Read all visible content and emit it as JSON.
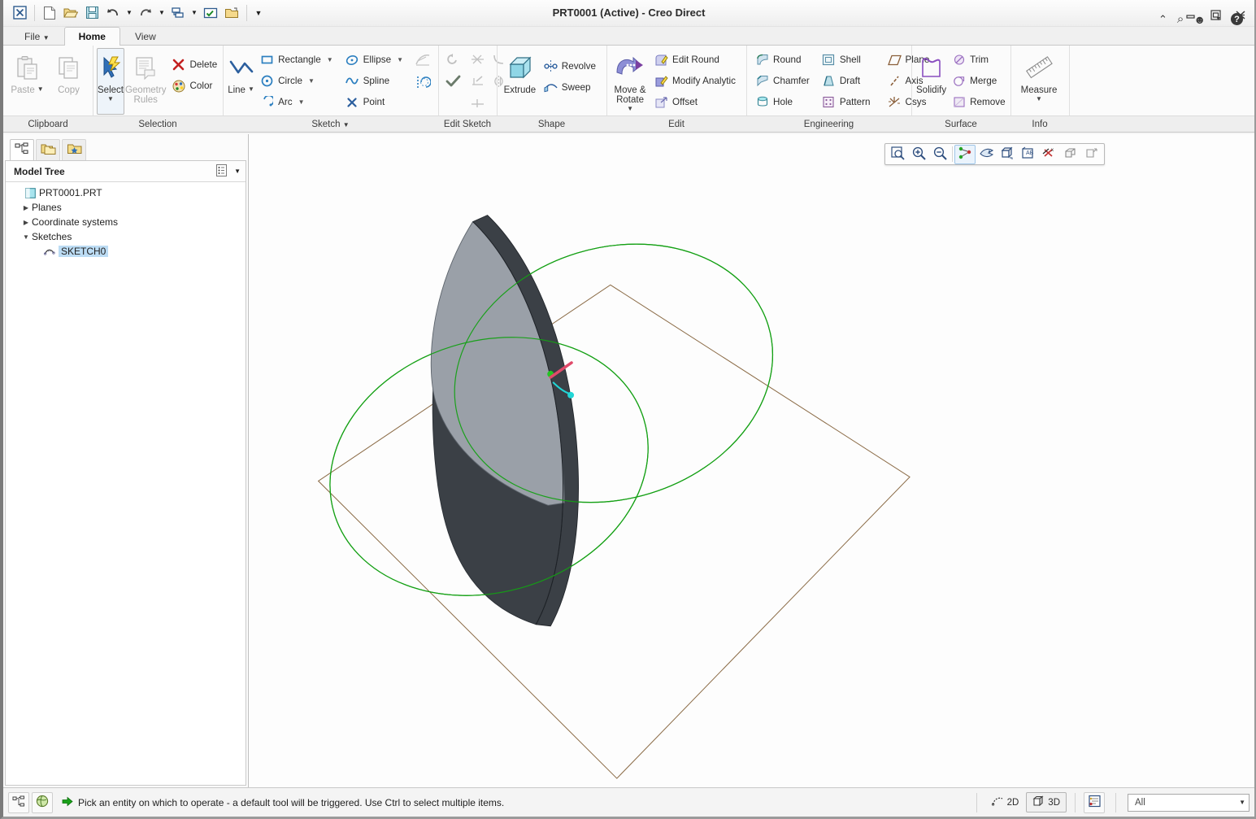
{
  "window": {
    "title": "PRT0001 (Active) - Creo Direct",
    "controls": [
      {
        "name": "minimize-button",
        "glyph": "–"
      },
      {
        "name": "restore-button",
        "glyph": "❐"
      },
      {
        "name": "close-button",
        "glyph": "✖"
      }
    ]
  },
  "quick_access": [
    {
      "name": "app-logo-icon",
      "label": "Creo Direct"
    },
    {
      "name": "new-icon",
      "label": "New"
    },
    {
      "name": "open-icon",
      "label": "Open"
    },
    {
      "name": "save-icon",
      "label": "Save"
    },
    {
      "name": "undo-icon",
      "label": "Undo"
    },
    {
      "name": "redo-icon",
      "label": "Redo"
    },
    {
      "name": "regenerate-icon",
      "label": "Regenerate"
    },
    {
      "name": "select-working-directory-icon",
      "label": "Select Working Directory"
    },
    {
      "name": "open-last-session-icon",
      "label": "Open Last Session"
    },
    {
      "name": "customize-quick-access-icon",
      "label": "Customize Quick Access Toolbar"
    }
  ],
  "help_icons": [
    {
      "name": "minimize-ribbon-icon",
      "glyph": "⌃"
    },
    {
      "name": "search-icon",
      "glyph": "⌕"
    },
    {
      "name": "account-icon",
      "glyph": "☺"
    },
    {
      "name": "account-dropdown-icon",
      "glyph": "▼"
    },
    {
      "name": "help-icon",
      "glyph": "?"
    }
  ],
  "tabs": [
    {
      "label": "File",
      "active": false,
      "has_caret": true
    },
    {
      "label": "Home",
      "active": true,
      "has_caret": false
    },
    {
      "label": "View",
      "active": false,
      "has_caret": false
    }
  ],
  "ribbon": {
    "groups": [
      {
        "name": "clipboard",
        "label": "Clipboard",
        "big_buttons": [
          {
            "label": "Paste",
            "icon": "paste-icon",
            "caret": true,
            "disabled": true
          },
          {
            "label": "Copy",
            "icon": "copy-icon",
            "caret": false,
            "disabled": true
          }
        ]
      },
      {
        "name": "selection",
        "label": "Selection",
        "big_buttons": [
          {
            "label": "Select",
            "icon": "select-arrow-icon",
            "caret": true,
            "disabled": false,
            "selected": true
          },
          {
            "label": "Geometry Rules",
            "icon": "geometry-rules-icon",
            "caret": false,
            "disabled": true
          }
        ],
        "small_buttons": [
          {
            "label": "Delete",
            "icon": "delete-icon",
            "disabled": false
          },
          {
            "label": "Color",
            "icon": "color-icon",
            "disabled": false
          }
        ]
      },
      {
        "name": "sketch",
        "label": "Sketch",
        "label_caret": true,
        "big_buttons": [
          {
            "label": "Line",
            "icon": "line-icon",
            "caret": true,
            "disabled": false
          }
        ],
        "columns": [
          [
            {
              "label": "Rectangle",
              "icon": "rectangle-icon",
              "caret": true
            },
            {
              "label": "Circle",
              "icon": "circle-icon",
              "caret": true
            },
            {
              "label": "Arc",
              "icon": "arc-icon",
              "caret": true
            }
          ],
          [
            {
              "label": "Ellipse",
              "icon": "ellipse-icon",
              "caret": true
            },
            {
              "label": "Spline",
              "icon": "spline-icon",
              "caret": false
            },
            {
              "label": "Point",
              "icon": "point-icon",
              "caret": false
            }
          ]
        ],
        "icon_only": [
          {
            "name": "chamfer-sketch-icon",
            "disabled": true
          },
          {
            "name": "offset-edge-icon",
            "disabled": false
          }
        ]
      },
      {
        "name": "edit-sketch",
        "label": "Edit Sketch",
        "icon_only": [
          {
            "name": "undo-sketch-icon",
            "disabled": true
          },
          {
            "name": "accept-sketch-icon",
            "disabled": false
          },
          {
            "name": "trim-sketch-icon",
            "disabled": true
          },
          {
            "name": "corner-sketch-icon",
            "disabled": true
          },
          {
            "name": "extend-sketch-icon",
            "disabled": true
          },
          {
            "name": "mirror-sketch-icon",
            "disabled": true
          },
          {
            "name": "divide-sketch-icon",
            "disabled": true
          }
        ]
      },
      {
        "name": "shape",
        "label": "Shape",
        "big_buttons": [
          {
            "label": "Extrude",
            "icon": "extrude-icon",
            "caret": false,
            "disabled": false
          }
        ],
        "small_buttons": [
          {
            "label": "Revolve",
            "icon": "revolve-icon"
          },
          {
            "label": "Sweep",
            "icon": "sweep-icon"
          }
        ]
      },
      {
        "name": "edit",
        "label": "Edit",
        "big_buttons": [
          {
            "label": "Move & Rotate",
            "icon": "move-rotate-icon",
            "caret": true,
            "disabled": false
          }
        ],
        "small_buttons": [
          {
            "label": "Edit Round",
            "icon": "edit-round-icon"
          },
          {
            "label": "Modify Analytic",
            "icon": "modify-analytic-icon"
          },
          {
            "label": "Offset",
            "icon": "offset-icon"
          }
        ]
      },
      {
        "name": "engineering",
        "label": "Engineering",
        "columns": [
          [
            {
              "label": "Round",
              "icon": "round-icon"
            },
            {
              "label": "Chamfer",
              "icon": "chamfer-icon"
            },
            {
              "label": "Hole",
              "icon": "hole-icon"
            }
          ],
          [
            {
              "label": "Shell",
              "icon": "shell-icon"
            },
            {
              "label": "Draft",
              "icon": "draft-icon"
            },
            {
              "label": "Pattern",
              "icon": "pattern-icon"
            }
          ],
          [
            {
              "label": "Plane",
              "icon": "plane-icon"
            },
            {
              "label": "Axis",
              "icon": "axis-icon"
            },
            {
              "label": "Csys",
              "icon": "csys-icon"
            }
          ]
        ]
      },
      {
        "name": "surface",
        "label": "Surface",
        "big_buttons": [
          {
            "label": "Solidify",
            "icon": "solidify-icon",
            "caret": false,
            "disabled": false
          }
        ],
        "columns": [
          [
            {
              "label": "Trim",
              "icon": "trim-icon"
            },
            {
              "label": "Merge",
              "icon": "merge-icon"
            },
            {
              "label": "Remove",
              "icon": "remove-icon"
            }
          ]
        ]
      },
      {
        "name": "info",
        "label": "Info",
        "big_buttons": [
          {
            "label": "Measure",
            "icon": "measure-icon",
            "caret": true,
            "disabled": false
          }
        ]
      }
    ]
  },
  "left_panel": {
    "nav_tabs": [
      {
        "name": "model-tree-tab",
        "icon": "model-tree-icon",
        "active": true
      },
      {
        "name": "folder-browser-tab",
        "icon": "folder-browser-icon",
        "active": false
      },
      {
        "name": "favorites-tab",
        "icon": "favorites-folder-icon",
        "active": false
      }
    ],
    "tree_header": {
      "title": "Model Tree",
      "settings_icon": "tree-settings-icon",
      "dropdown_icon": "chevron-down-icon"
    },
    "tree": [
      {
        "label": "PRT0001.PRT",
        "indent": 0,
        "twist": "",
        "icon": "part-icon",
        "selected": false
      },
      {
        "label": "Planes",
        "indent": 1,
        "twist": "▶",
        "icon": "",
        "selected": false
      },
      {
        "label": "Coordinate systems",
        "indent": 1,
        "twist": "▶",
        "icon": "",
        "selected": false
      },
      {
        "label": "Sketches",
        "indent": 1,
        "twist": "▼",
        "icon": "",
        "selected": false
      },
      {
        "label": "SKETCH0",
        "indent": 2,
        "twist": "",
        "icon": "sketch-icon",
        "selected": true
      }
    ]
  },
  "graphics_toolbar": [
    {
      "name": "refit-icon",
      "active": false
    },
    {
      "name": "zoom-in-icon",
      "active": false
    },
    {
      "name": "zoom-out-icon",
      "active": false
    },
    {
      "name": "datum-display-icon",
      "active": true
    },
    {
      "name": "saved-orientations-icon",
      "active": false
    },
    {
      "name": "display-style-icon",
      "active": false
    },
    {
      "name": "annotation-display-icon",
      "active": false
    },
    {
      "name": "spin-center-icon",
      "active": false
    },
    {
      "name": "perspective-view-icon",
      "active": false
    },
    {
      "name": "appearance-icon",
      "active": false
    }
  ],
  "viewport": {
    "colors": {
      "background": "#fdfdfd",
      "datum_plane_outline": "#8a6a45",
      "sketch_curve": "#10a010",
      "solid_light_face": "#9aa0a8",
      "solid_dark_face": "#3b4046",
      "csys_x": "#e04a6a",
      "csys_y": "#24c424",
      "csys_z": "#22d6d6"
    },
    "entities": [
      {
        "name": "datum-plane-sketch-plane",
        "type": "plane-outline"
      },
      {
        "name": "sketch-circle-upper-right",
        "type": "circle"
      },
      {
        "name": "sketch-circle-lower-left",
        "type": "circle"
      },
      {
        "name": "extruded-lens-solid",
        "type": "solid"
      },
      {
        "name": "coordinate-system-marker",
        "type": "csys"
      }
    ]
  },
  "status_bar": {
    "left_buttons": [
      {
        "name": "model-tree-toggle-icon"
      },
      {
        "name": "browser-toggle-icon"
      }
    ],
    "message_icon": "green-arrow-icon",
    "message": "Pick an entity on which to operate - a default tool will be triggered. Use Ctrl to select multiple items.",
    "view_modes": [
      {
        "label": "2D",
        "name": "view-mode-2d",
        "active": false,
        "icon": "2d-icon"
      },
      {
        "label": "3D",
        "name": "view-mode-3d",
        "active": true,
        "icon": "3d-icon"
      }
    ],
    "detail_button": {
      "name": "selection-details-icon"
    },
    "selection_filter": {
      "value": "All",
      "name": "selection-filter-select"
    }
  }
}
